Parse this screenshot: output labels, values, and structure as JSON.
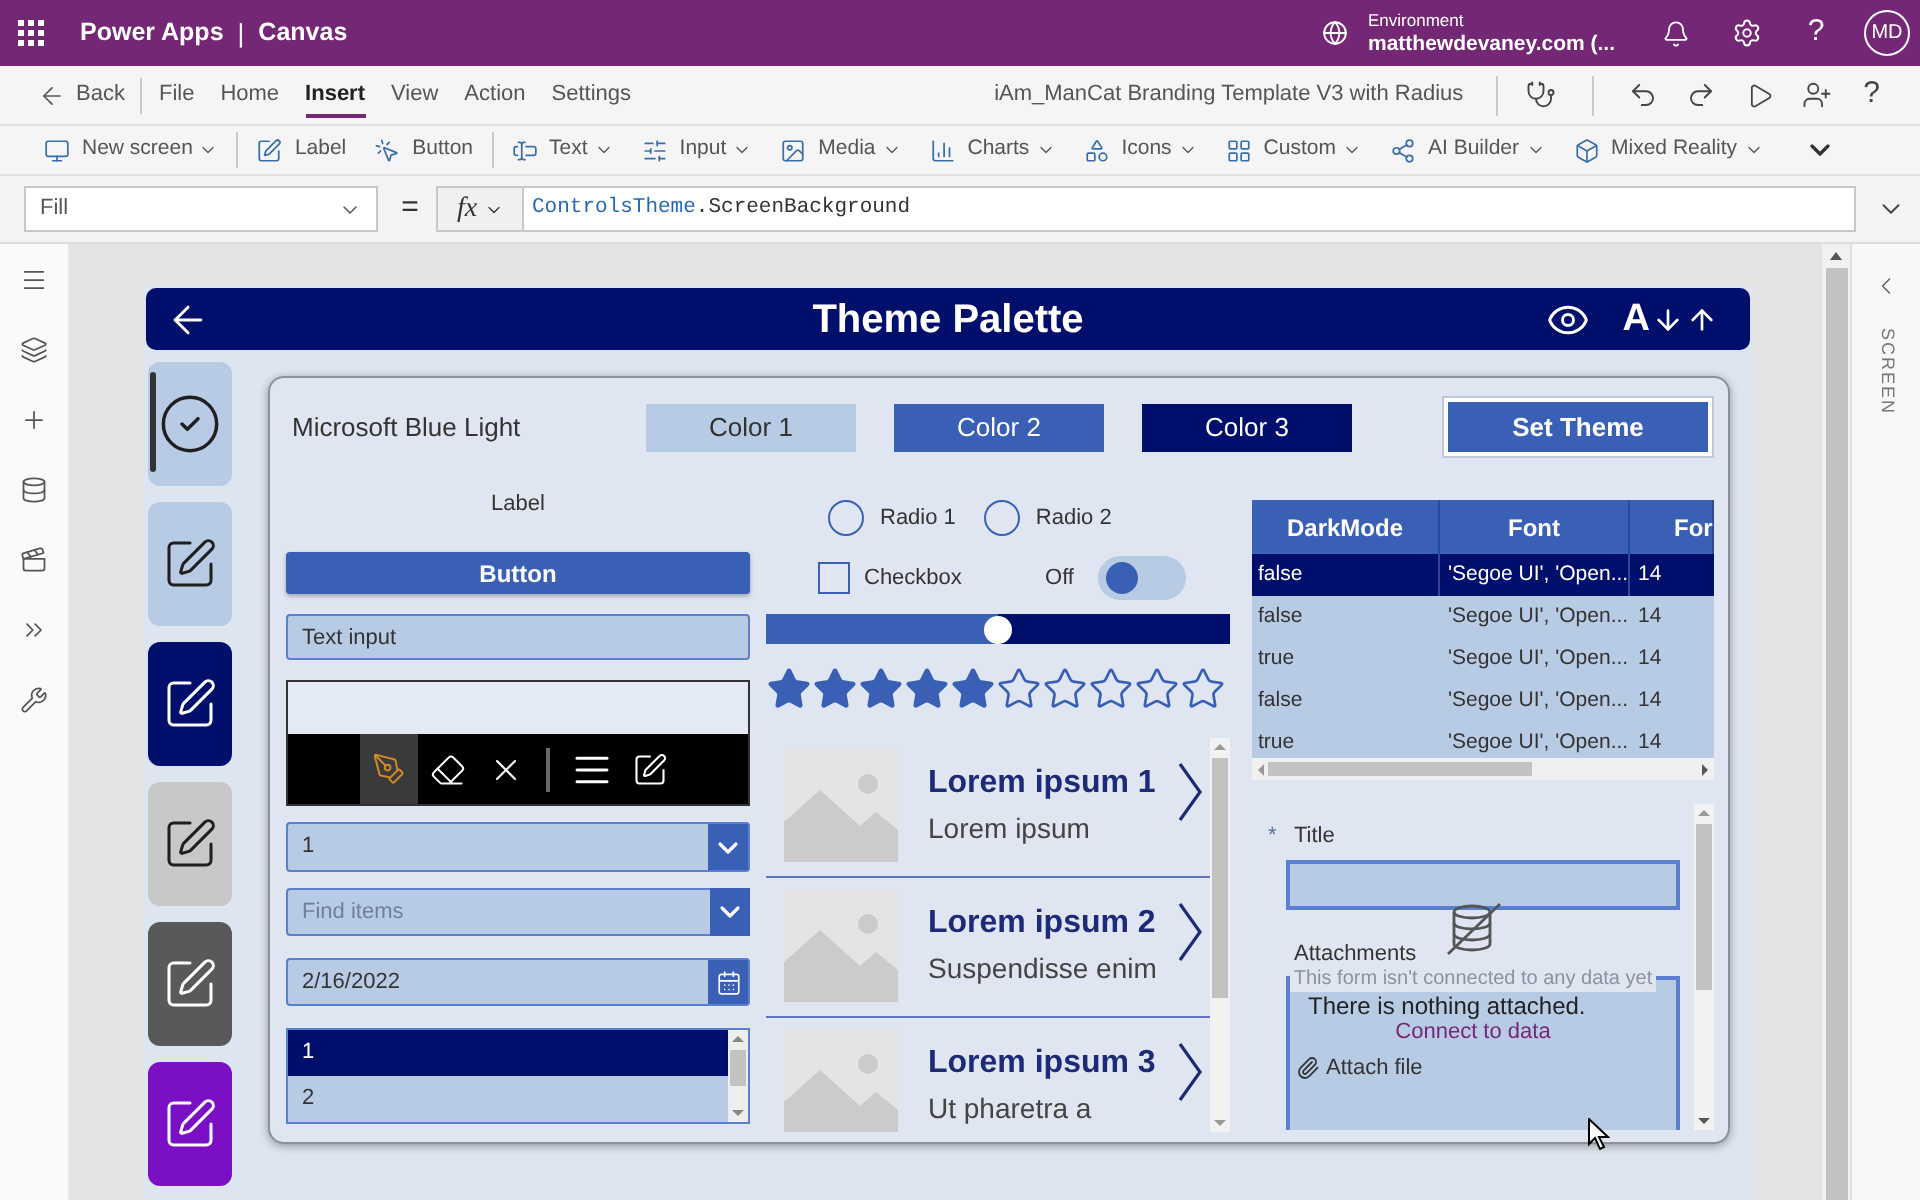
{
  "top_bar": {
    "product": "Power Apps",
    "divider": "|",
    "mode": "Canvas",
    "environment_caption": "Environment",
    "environment": "matthewdevaney.com (...",
    "help": "?",
    "avatar_initials": "MD"
  },
  "menu_bar": {
    "back": "Back",
    "tabs": [
      {
        "label": "File",
        "selected": false
      },
      {
        "label": "Home",
        "selected": false
      },
      {
        "label": "Insert",
        "selected": true
      },
      {
        "label": "View",
        "selected": false
      },
      {
        "label": "Action",
        "selected": false
      },
      {
        "label": "Settings",
        "selected": false
      }
    ],
    "document_title": "iAm_ManCat Branding Template V3 with Radius",
    "help": "?"
  },
  "ribbon": {
    "groups": [
      {
        "items": [
          {
            "label": "New screen",
            "dropdown": true
          }
        ]
      },
      {
        "items": [
          {
            "label": "Label",
            "dropdown": false
          },
          {
            "label": "Button",
            "dropdown": false
          }
        ]
      },
      {
        "items": [
          {
            "label": "Text",
            "dropdown": true
          },
          {
            "label": "Input",
            "dropdown": true
          },
          {
            "label": "Media",
            "dropdown": true
          },
          {
            "label": "Charts",
            "dropdown": true
          },
          {
            "label": "Icons",
            "dropdown": true
          },
          {
            "label": "Custom",
            "dropdown": true
          },
          {
            "label": "AI Builder",
            "dropdown": true
          },
          {
            "label": "Mixed Reality",
            "dropdown": true
          }
        ]
      }
    ]
  },
  "formula_bar": {
    "property": "Fill",
    "equals": "=",
    "function_label": "fx",
    "formula": [
      {
        "kind": "identifier",
        "text": "ControlsTheme"
      },
      {
        "kind": "member",
        "text": ".ScreenBackground"
      }
    ]
  },
  "app_screen": {
    "header": {
      "title": "Theme Palette",
      "sort_letter": "A"
    },
    "nav_tiles": [
      {
        "kind": "check",
        "color": "#b8cbe4",
        "selected": true
      },
      {
        "kind": "edit",
        "color": "#b8cbe4",
        "selected": false
      },
      {
        "kind": "edit",
        "color": "#000f6b",
        "selected": false
      },
      {
        "kind": "edit",
        "color": "#c8c8c8",
        "selected": false
      },
      {
        "kind": "edit",
        "color": "#595959",
        "selected": false
      },
      {
        "kind": "edit",
        "color": "#7a0fc4",
        "selected": false
      }
    ],
    "theme_name": "Microsoft Blue Light",
    "swatches": [
      {
        "label": "Color 1",
        "color": "#b8cbe4"
      },
      {
        "label": "Color 2",
        "color": "#3a60b5"
      },
      {
        "label": "Color 3",
        "color": "#000f6b"
      }
    ],
    "set_theme_button": "Set Theme",
    "label_control": "Label",
    "button_control": "Button",
    "text_input": {
      "value": "Text input"
    },
    "pen_input": {
      "tool_groups": [
        {
          "tools": [
            {
              "kind": "pen",
              "selected": true
            },
            {
              "kind": "eraser",
              "selected": false
            },
            {
              "kind": "clear",
              "selected": false
            }
          ]
        },
        {
          "tools": [
            {
              "kind": "thickness",
              "selected": false
            },
            {
              "kind": "edit",
              "selected": false
            }
          ]
        }
      ]
    },
    "dropdown": {
      "value": "1"
    },
    "combo_box": {
      "placeholder": "Find items"
    },
    "date_picker": {
      "value": "2/16/2022"
    },
    "list_box": {
      "items": [
        {
          "label": "1",
          "selected": true
        },
        {
          "label": "2",
          "selected": false
        }
      ]
    },
    "radios": [
      {
        "label": "Radio 1",
        "selected": false
      },
      {
        "label": "Radio 2",
        "selected": false
      }
    ],
    "checkbox": {
      "label": "Checkbox",
      "checked": false
    },
    "toggle": {
      "label": "Off",
      "on": false
    },
    "slider": {
      "level": 0.5
    },
    "rating": {
      "stars": 5
    },
    "gallery": [
      {
        "title": "Lorem ipsum 1",
        "subtitle": "Lorem ipsum"
      },
      {
        "title": "Lorem ipsum 2",
        "subtitle": "Suspendisse enim"
      },
      {
        "title": "Lorem ipsum 3",
        "subtitle": "Ut pharetra a"
      }
    ],
    "data_table": {
      "columns": [
        "DarkMode",
        "Font",
        "For"
      ],
      "rows": [
        {
          "selected": true,
          "cells": [
            "false",
            "'Segoe UI', 'Open...",
            "14"
          ]
        },
        {
          "selected": false,
          "cells": [
            "false",
            "'Segoe UI', 'Open...",
            "14"
          ]
        },
        {
          "selected": false,
          "cells": [
            "true",
            "'Segoe UI', 'Open...",
            "14"
          ]
        },
        {
          "selected": false,
          "cells": [
            "false",
            "'Segoe UI', 'Open...",
            "14"
          ]
        },
        {
          "selected": false,
          "cells": [
            "true",
            "'Segoe UI', 'Open...",
            "14"
          ]
        }
      ]
    },
    "form": {
      "required_marker": "*",
      "fields": [
        {
          "kind": "text",
          "label": "Title",
          "required": true
        },
        {
          "kind": "attachments",
          "label": "Attachments",
          "required": false,
          "empty_text": "There is nothing attached.",
          "action": "Attach file"
        }
      ],
      "no_data_message": "This form isn't connected to any data yet",
      "connect_link": "Connect to data"
    }
  },
  "side_panel": {
    "title": "SCREEN"
  }
}
